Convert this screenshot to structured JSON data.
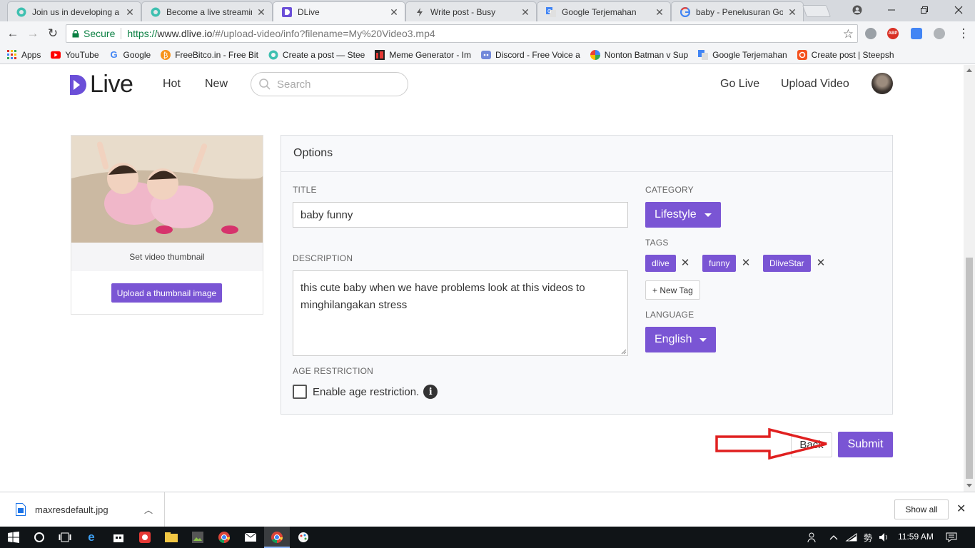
{
  "browser": {
    "tabs": [
      {
        "title": "Join us in developing a",
        "icon": "steem-icon",
        "active": false
      },
      {
        "title": "Become a live streamin",
        "icon": "steem-icon",
        "active": false
      },
      {
        "title": "DLive",
        "icon": "dlive-icon",
        "active": true
      },
      {
        "title": "Write post - Busy",
        "icon": "busy-icon",
        "active": false
      },
      {
        "title": "Google Terjemahan",
        "icon": "google-translate-icon",
        "active": false
      },
      {
        "title": "baby - Penelusuran Goo",
        "icon": "google-icon",
        "active": false
      }
    ],
    "secure_label": "Secure",
    "url_scheme": "https://",
    "url_host": "www.dlive.io",
    "url_path": "/#/upload-video/info?filename=My%20Video3.mp4",
    "bookmarks": [
      {
        "label": "Apps",
        "icon": "apps-grid-icon"
      },
      {
        "label": "YouTube",
        "icon": "youtube-icon"
      },
      {
        "label": "Google",
        "icon": "google-icon"
      },
      {
        "label": "FreeBitco.in - Free Bit",
        "icon": "bitcoin-icon"
      },
      {
        "label": "Create a post — Stee",
        "icon": "steem-icon"
      },
      {
        "label": "Meme Generator - Im",
        "icon": "imgflip-icon"
      },
      {
        "label": "Discord - Free Voice a",
        "icon": "discord-icon"
      },
      {
        "label": "Nonton Batman v Sup",
        "icon": "pinwheel-icon"
      },
      {
        "label": "Google Terjemahan",
        "icon": "google-translate-icon"
      },
      {
        "label": "Create post | Steepsh",
        "icon": "steepshot-icon"
      }
    ],
    "colors": {
      "secure_green": "#0b8043",
      "accent": "#7a55d4",
      "arrow_red": "#e02020"
    }
  },
  "header": {
    "logo_text": "Live",
    "nav": {
      "hot": "Hot",
      "new": "New"
    },
    "search_placeholder": "Search",
    "go_live": "Go Live",
    "upload_video": "Upload Video"
  },
  "thumbnail": {
    "caption": "Set video thumbnail",
    "upload_button": "Upload a thumbnail image"
  },
  "options": {
    "heading": "Options",
    "title_label": "TITLE",
    "title_value": "baby funny",
    "description_label": "DESCRIPTION",
    "description_value": "this cute baby when we have problems look at this videos to minghilangakan stress",
    "age_label": "AGE RESTRICTION",
    "age_checkbox_text": "Enable age restriction.",
    "age_checked": false,
    "category_label": "CATEGORY",
    "category_value": "Lifestyle",
    "tags_label": "TAGS",
    "tags": [
      "dlive",
      "funny",
      "DliveStar"
    ],
    "new_tag_label": "+ New Tag",
    "language_label": "LANGUAGE",
    "language_value": "English"
  },
  "actions": {
    "back": "Back",
    "submit": "Submit"
  },
  "downloads": {
    "file_name": "maxresdefault.jpg",
    "show_all": "Show all"
  },
  "taskbar": {
    "time": "11:59 AM"
  }
}
